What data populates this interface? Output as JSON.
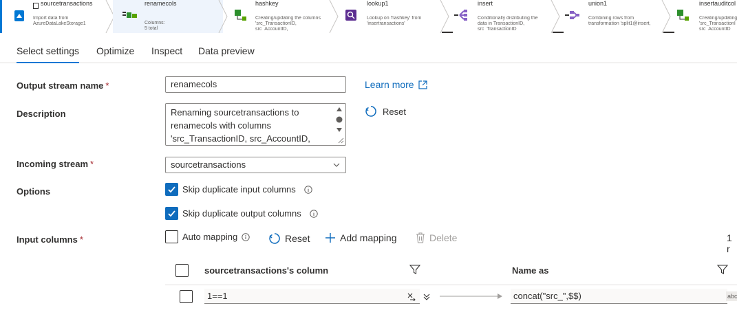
{
  "pipeline": {
    "nodes": [
      {
        "title": "sourcetransactions",
        "desc": "Import data from\nAzureDataLakeStorage1"
      },
      {
        "title": "renamecols",
        "desc": "Columns:\n5 total"
      },
      {
        "title": "hashkey",
        "desc": "Creating/updating the columns\n'src_TransactionID,\nsrc_AccountID,"
      },
      {
        "title": "lookup1",
        "desc": "Lookup on 'hashkey' from\n'insertransactions'"
      },
      {
        "title": "insert",
        "desc": "Conditionally distributing the\ndata in TransactionID,\nsrc_TransactionID"
      },
      {
        "title": "union1",
        "desc": "Combining rows from\ntransformation 'split1@insert,"
      },
      {
        "title": "insertauditcol",
        "desc": "Creating/updating\n'src_TransactionI\nsrc_AccountID"
      }
    ]
  },
  "tabs": [
    "Select settings",
    "Optimize",
    "Inspect",
    "Data preview"
  ],
  "form": {
    "output_stream_label": "Output stream name",
    "output_stream_value": "renamecols",
    "learn_more": "Learn more",
    "description_label": "Description",
    "description_value": "Renaming sourcetransactions to renamecols with columns 'src_TransactionID, src_AccountID,",
    "reset_label": "Reset",
    "incoming_stream_label": "Incoming stream",
    "incoming_stream_value": "sourcetransactions",
    "options_label": "Options",
    "skip_input_label": "Skip duplicate input columns",
    "skip_output_label": "Skip duplicate output columns",
    "input_columns_label": "Input columns",
    "required_mark": "*"
  },
  "toolbar": {
    "auto_mapping": "Auto mapping",
    "reset": "Reset",
    "add_mapping": "Add mapping",
    "delete": "Delete",
    "count": "1 r"
  },
  "grid": {
    "col1_header": "sourcetransactions's column",
    "col2_header": "Name as",
    "row_source": "1==1",
    "row_name": "concat(\"src_\",$$)",
    "row_type_badge": "abc"
  },
  "colors": {
    "accent": "#0f6cbd",
    "required": "#a4262c"
  }
}
